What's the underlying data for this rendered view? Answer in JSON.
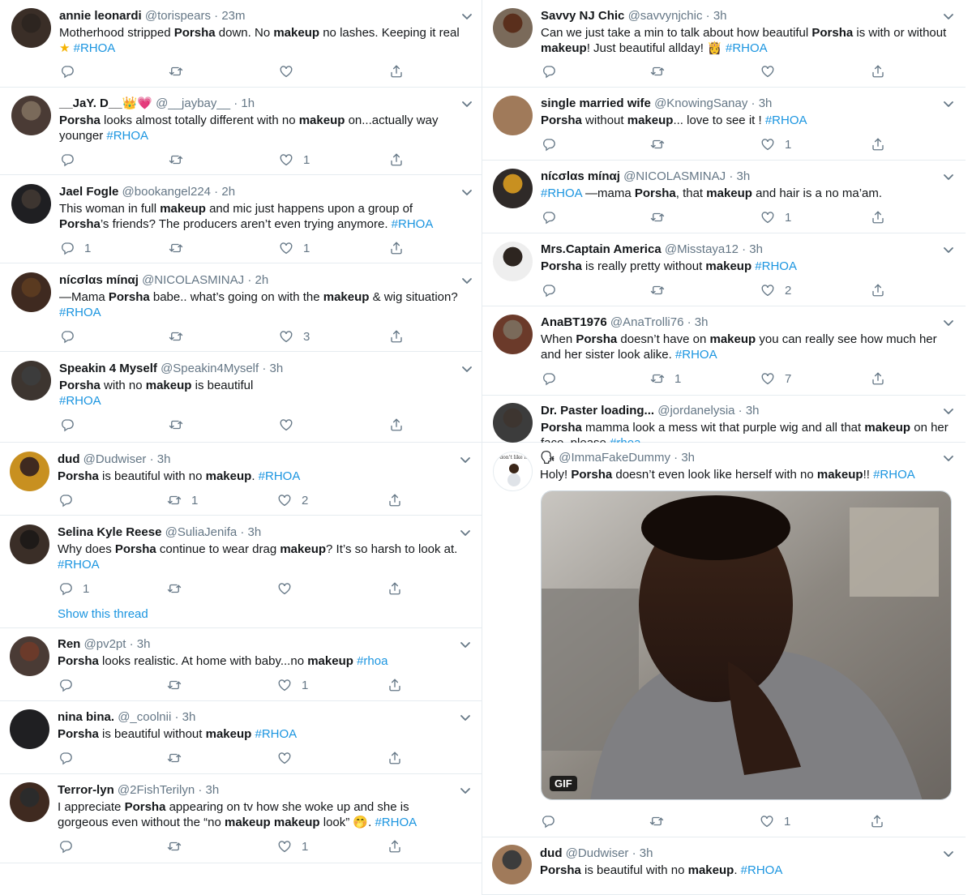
{
  "colors": {
    "link": "#1b95e0",
    "muted": "#657786",
    "text": "#14171a",
    "divider": "#e6ecf0"
  },
  "left": [
    {
      "name": "annie leonardi",
      "handle": "@torispears",
      "time": "23m",
      "star": true,
      "body": [
        [
          "Motherhood stripped "
        ],
        [
          "Porsha",
          "b"
        ],
        [
          " down. No "
        ],
        [
          "makeup",
          "b"
        ],
        [
          " no lashes. Keeping it real "
        ],
        [
          "★",
          "star"
        ],
        [
          " "
        ],
        [
          "#RHOA",
          "tag"
        ]
      ],
      "counts": {
        "reply": "",
        "retweet": "",
        "like": ""
      }
    },
    {
      "name": "__JaY. D__",
      "handle": "@__jaybay__",
      "time": "1h",
      "emoji": "👑💗",
      "body": [
        [
          "Porsha",
          "b"
        ],
        [
          " looks almost totally different with no "
        ],
        [
          "makeup",
          "b"
        ],
        [
          " on...actually way younger "
        ],
        [
          "#RHOA",
          "tag"
        ]
      ],
      "counts": {
        "reply": "",
        "retweet": "",
        "like": "1"
      }
    },
    {
      "name": "Jael Fogle",
      "handle": "@bookangel224",
      "time": "2h",
      "body": [
        [
          "This woman in full "
        ],
        [
          "makeup",
          "b"
        ],
        [
          " and mic just happens upon a group of "
        ],
        [
          "Porsha",
          "b"
        ],
        [
          "’s friends? The producers aren’t even trying anymore. "
        ],
        [
          "#RHOA",
          "tag"
        ]
      ],
      "counts": {
        "reply": "1",
        "retweet": "",
        "like": "1"
      }
    },
    {
      "name": "nícσlαs mínαj",
      "handle": "@NICOLASMINAJ",
      "time": "2h",
      "body": [
        [
          "—Mama "
        ],
        [
          "Porsha",
          "b"
        ],
        [
          " babe.. what’s going on with the "
        ],
        [
          "makeup",
          "b"
        ],
        [
          " & wig situation? "
        ],
        [
          "#RHOA",
          "tag"
        ]
      ],
      "counts": {
        "reply": "",
        "retweet": "",
        "like": "3"
      }
    },
    {
      "name": "Speakin 4 Myself",
      "handle": "@Speakin4Myself",
      "time": "3h",
      "body": [
        [
          "Porsha",
          "b"
        ],
        [
          " with no "
        ],
        [
          "makeup",
          "b"
        ],
        [
          " is beautiful"
        ],
        [
          "\n"
        ],
        [
          "#RHOA",
          "tag"
        ]
      ],
      "counts": {
        "reply": "",
        "retweet": "",
        "like": ""
      }
    },
    {
      "name": "dud",
      "handle": "@Dudwiser",
      "time": "3h",
      "body": [
        [
          "Porsha",
          "b"
        ],
        [
          " is beautiful with no "
        ],
        [
          "makeup",
          "b"
        ],
        [
          ". "
        ],
        [
          "#RHOA",
          "tag"
        ]
      ],
      "counts": {
        "reply": "",
        "retweet": "1",
        "like": "2"
      }
    },
    {
      "name": "Selina Kyle Reese",
      "handle": "@SuliaJenifa",
      "time": "3h",
      "body": [
        [
          "Why does "
        ],
        [
          "Porsha",
          "b"
        ],
        [
          " continue to wear drag "
        ],
        [
          "makeup",
          "b"
        ],
        [
          "? It’s so harsh to look at. "
        ],
        [
          "#RHOA",
          "tag"
        ]
      ],
      "counts": {
        "reply": "1",
        "retweet": "",
        "like": ""
      },
      "thread": "Show this thread"
    },
    {
      "name": "Ren",
      "handle": "@pv2pt",
      "time": "3h",
      "body": [
        [
          "Porsha",
          "b"
        ],
        [
          " looks realistic. At home with baby...no "
        ],
        [
          "makeup",
          "b"
        ],
        [
          " "
        ],
        [
          "#rhoa",
          "tag"
        ]
      ],
      "counts": {
        "reply": "",
        "retweet": "",
        "like": "1"
      }
    },
    {
      "name": "nina bina.",
      "handle": "@_coolnii",
      "time": "3h",
      "body": [
        [
          "Porsha",
          "b"
        ],
        [
          " is beautiful without "
        ],
        [
          "makeup",
          "b"
        ],
        [
          " "
        ],
        [
          "#RHOA",
          "tag"
        ]
      ],
      "counts": {
        "reply": "",
        "retweet": "",
        "like": ""
      }
    },
    {
      "name": "Terror-lyn",
      "handle": "@2FishTerilyn",
      "time": "3h",
      "body": [
        [
          "I appreciate "
        ],
        [
          "Porsha",
          "b"
        ],
        [
          " appearing on tv how she woke up and she is gorgeous even without the “no "
        ],
        [
          "makeup",
          "b"
        ],
        [
          " "
        ],
        [
          "makeup",
          "b"
        ],
        [
          " look” "
        ],
        [
          "🤭"
        ],
        [
          ". "
        ],
        [
          "#RHOA",
          "tag"
        ]
      ],
      "counts": {
        "reply": "",
        "retweet": "",
        "like": "1"
      }
    }
  ],
  "right": [
    {
      "name": "Savvy NJ Chic",
      "handle": "@savvynjchic",
      "time": "3h",
      "body": [
        [
          "Can we just take a min to talk about how beautiful "
        ],
        [
          "Porsha",
          "b"
        ],
        [
          " is with or without "
        ],
        [
          "makeup",
          "b"
        ],
        [
          "! Just beautiful allday!  "
        ],
        [
          "👸"
        ],
        [
          " "
        ],
        [
          "#RHOA",
          "tag"
        ]
      ],
      "counts": {
        "reply": "",
        "retweet": "",
        "like": ""
      }
    },
    {
      "name": "single married wife",
      "handle": "@KnowingSanay",
      "time": "3h",
      "body": [
        [
          "Porsha",
          "b"
        ],
        [
          " without "
        ],
        [
          "makeup",
          "b"
        ],
        [
          "... love to see it ! "
        ],
        [
          "#RHOA",
          "tag"
        ]
      ],
      "counts": {
        "reply": "",
        "retweet": "",
        "like": "1"
      }
    },
    {
      "name": "nícσlαs mínαj",
      "handle": "@NICOLASMINAJ",
      "time": "3h",
      "body": [
        [
          "#RHOA",
          "tag"
        ],
        [
          " —mama "
        ],
        [
          "Porsha",
          "b"
        ],
        [
          ", that "
        ],
        [
          "makeup",
          "b"
        ],
        [
          " and hair is a no ma’am."
        ]
      ],
      "counts": {
        "reply": "",
        "retweet": "",
        "like": "1"
      }
    },
    {
      "name": "Mrs.Captain America",
      "handle": "@Misstaya12",
      "time": "3h",
      "body": [
        [
          "Porsha",
          "b"
        ],
        [
          " is really pretty without "
        ],
        [
          "makeup",
          "b"
        ],
        [
          " "
        ],
        [
          "#RHOA",
          "tag"
        ]
      ],
      "counts": {
        "reply": "",
        "retweet": "",
        "like": "2"
      }
    },
    {
      "name": "AnaBT1976",
      "handle": "@AnaTrolli76",
      "time": "3h",
      "body": [
        [
          "When "
        ],
        [
          "Porsha",
          "b"
        ],
        [
          " doesn’t have on "
        ],
        [
          "makeup",
          "b"
        ],
        [
          " you can really see how much her and her sister look alike. "
        ],
        [
          "#RHOA",
          "tag"
        ]
      ],
      "counts": {
        "reply": "",
        "retweet": "1",
        "like": "7"
      }
    },
    {
      "name": "Dr. Paster loading...",
      "handle": "@jordanelysia",
      "time": "3h",
      "body": [
        [
          "Porsha",
          "b"
        ],
        [
          " mamma look a mess wit that purple wig and all that "
        ],
        [
          "makeup",
          "b"
        ],
        [
          " on her face, please "
        ],
        [
          "#rhoa",
          "tag"
        ]
      ],
      "counts": {
        "reply": "",
        "retweet": "",
        "like": ""
      },
      "clipped": true
    },
    {
      "name": "🗣",
      "handle": "@ImmaFakeDummy",
      "time": "3h",
      "avatar_caption": "I don't like it.",
      "body": [
        [
          "Holy! "
        ],
        [
          "Porsha",
          "b"
        ],
        [
          " doesn’t even look like herself with no "
        ],
        [
          "makeup",
          "b"
        ],
        [
          "!!  "
        ],
        [
          "#RHOA",
          "tag"
        ]
      ],
      "counts": {
        "reply": "",
        "retweet": "",
        "like": "1"
      },
      "gif": "GIF"
    },
    {
      "name": "dud",
      "handle": "@Dudwiser",
      "time": "3h",
      "body": [
        [
          "Porsha",
          "b"
        ],
        [
          " is beautiful with no "
        ],
        [
          "makeup",
          "b"
        ],
        [
          ". "
        ],
        [
          "#RHOA",
          "tag"
        ]
      ],
      "counts": {
        "reply": "",
        "retweet": "",
        "like": ""
      }
    }
  ],
  "icons": [
    "reply-icon",
    "retweet-icon",
    "like-icon",
    "share-icon",
    "chevron-down-icon",
    "gif-badge"
  ]
}
